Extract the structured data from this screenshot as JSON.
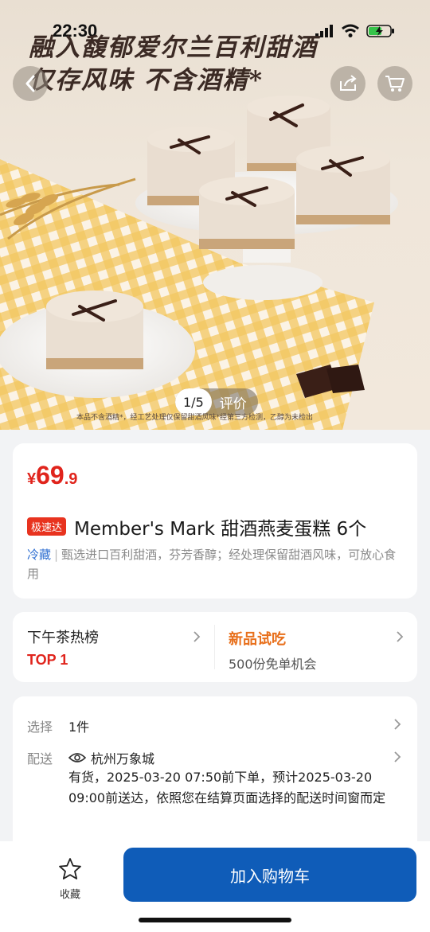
{
  "status": {
    "time": "22:30"
  },
  "hero": {
    "headline_line1": "融入馥郁爱尔兰百利甜酒",
    "headline_line2": "仅存风味 不含酒精*",
    "counter_index": "1/5",
    "review_label": "评价",
    "disclaimer": "本品不含酒精*，经工艺处理仅保留甜酒风味*经第三方检测，乙醇为未检出"
  },
  "product": {
    "currency": "¥",
    "price_int": "69",
    "price_dec": ".9",
    "badge": "极速达",
    "title": "Member's Mark 甜酒燕麦蛋糕 6个",
    "tag": "冷藏",
    "description": "甄选进口百利甜酒，芬芳香醇；经处理保留甜酒风味，可放心食用"
  },
  "promo": {
    "left_title": "下午茶热榜",
    "left_rank": "TOP 1",
    "right_title": "新品试吃",
    "right_sub": "500份免单机会"
  },
  "delivery": {
    "select_label": "选择",
    "select_value": "1件",
    "ship_label": "配送",
    "store": "杭州万象城",
    "detail": "有货，2025-03-20 07:50前下单，预计2025-03-20 09:00前送达，依照您在结算页面选择的配送时间窗而定"
  },
  "bottom": {
    "fav_label": "收藏",
    "add_cart_label": "加入购物车"
  },
  "colors": {
    "price_red": "#e0241c",
    "primary_blue": "#0f5cb8",
    "promo_orange": "#e8701c",
    "tag_blue": "#2f6fd1"
  }
}
